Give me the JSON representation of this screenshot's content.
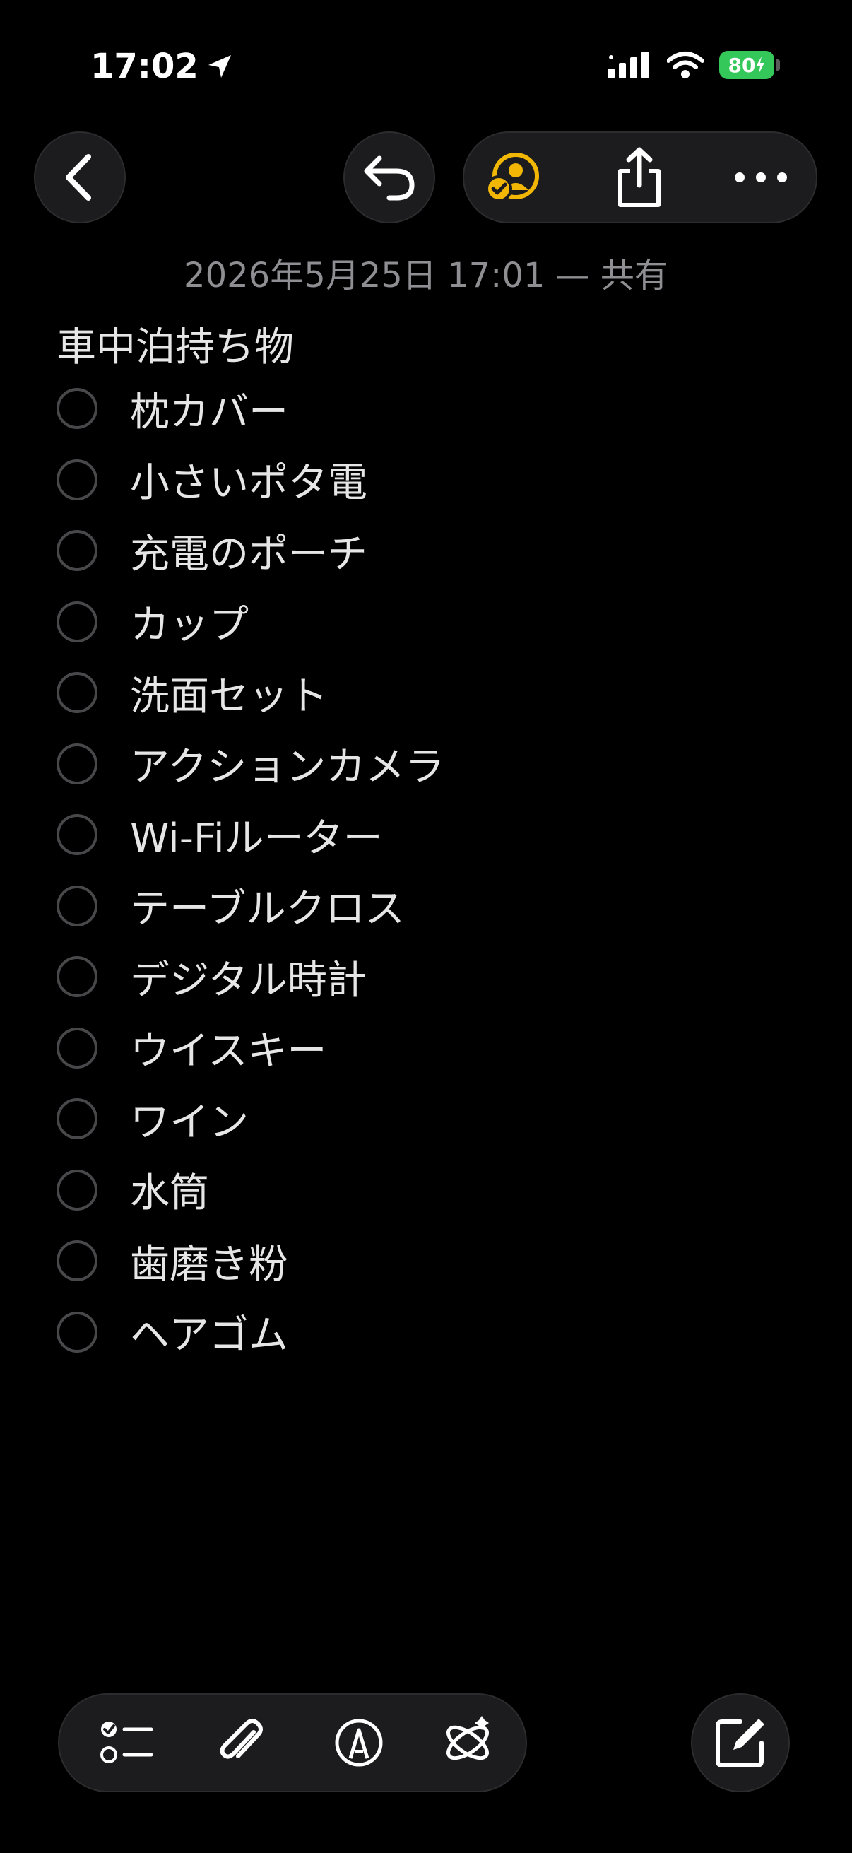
{
  "status": {
    "time": "17:02",
    "battery": "80"
  },
  "note": {
    "meta": "2026年5月25日 17:01 — 共有",
    "title": "車中泊持ち物",
    "items": [
      "枕カバー",
      "小さいポタ電",
      "充電のポーチ",
      "カップ",
      "洗面セット",
      "アクションカメラ",
      "Wi-Fiルーター",
      "テーブルクロス",
      "デジタル時計",
      "ウイスキー",
      "ワイン",
      "水筒",
      "歯磨き粉",
      "ヘアゴム"
    ]
  },
  "icons": {
    "back": "chevron-left-icon",
    "undo": "undo-icon",
    "collab": "shared-person-icon",
    "share": "share-icon",
    "more": "ellipsis-icon",
    "checklist": "checklist-icon",
    "attach": "paperclip-icon",
    "markup": "pen-tip-icon",
    "ai": "apple-intelligence-icon",
    "compose": "compose-icon"
  },
  "colors": {
    "accent": "#f2b705",
    "battery": "#34c759",
    "background": "#000000"
  }
}
